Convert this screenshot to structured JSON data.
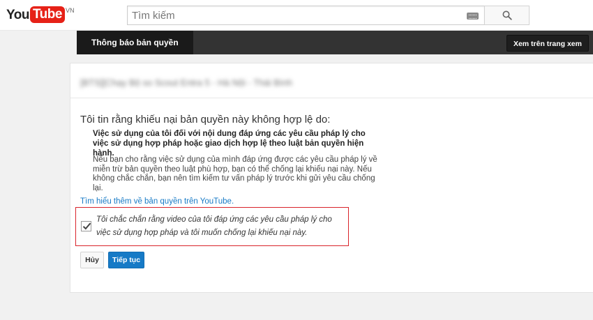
{
  "masthead": {
    "logo_you": "You",
    "logo_tube": "Tube",
    "logo_country": "VN",
    "search_placeholder": "Tìm kiếm",
    "keyboard_icon": "keyboard-icon",
    "search_icon": "search-icon"
  },
  "guide": {
    "title": "Thông báo bản quyền",
    "view_button": "Xem trên trang xem"
  },
  "content": {
    "video_title_blurred": "[BTS][Chạy Bộ so Scout Entra 5 - Hà Nội - Thái Bình",
    "heading": "Tôi tin rằng khiếu nại bản quyền này không hợp lệ do:",
    "reason": "Việc sử dụng của tôi đối với nội dung đáp ứng các yêu cầu pháp lý cho việc sử dụng hợp pháp hoặc giao dịch hợp lệ theo luật bản quyền hiện hành.",
    "explanation": "Nếu bạn cho rằng việc sử dụng của mình đáp ứng được các yêu cầu pháp lý về miễn trừ bản quyền theo luật phù hợp, bạn có thể chống lại khiếu nại này. Nếu không chắc chắn, bạn nên tìm kiếm tư vấn pháp lý trước khi gửi yêu cầu chống lại.",
    "learn_more_link": "Tìm hiểu thêm về bản quyền trên YouTube.",
    "confirm_text": "Tôi chắc chắn rằng video của tôi đáp ứng các yêu cầu pháp lý cho việc sử dụng hợp pháp và tôi muốn chống lại khiếu nại này.",
    "confirm_checked": true,
    "cancel_button": "Hủy",
    "continue_button": "Tiếp tục"
  },
  "colors": {
    "brand_red": "#e62117",
    "link_blue": "#167ac6",
    "highlight_red": "#d9232a",
    "header_dark": "#333333"
  }
}
